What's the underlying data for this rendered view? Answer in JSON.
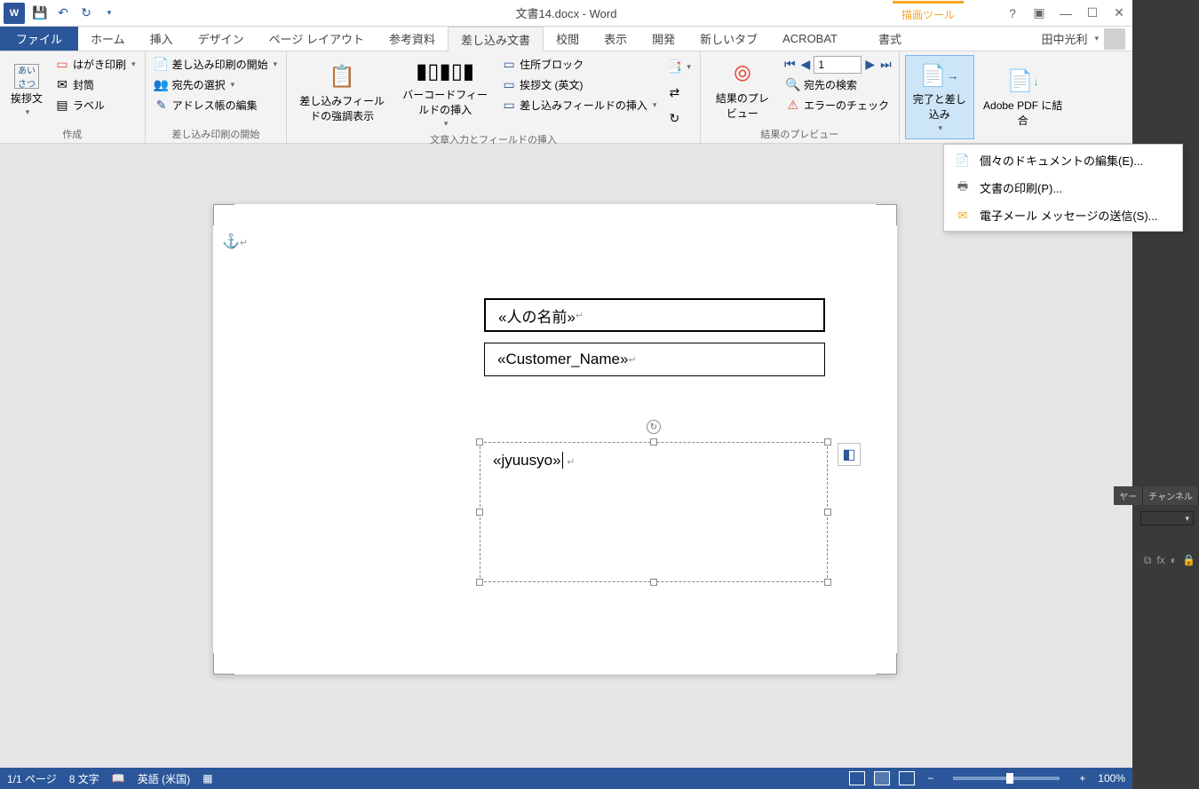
{
  "titlebar": {
    "title": "文書14.docx - Word",
    "contextual_tool": "描画ツール"
  },
  "tabs": {
    "file": "ファイル",
    "items": [
      "ホーム",
      "挿入",
      "デザイン",
      "ページ レイアウト",
      "参考資料",
      "差し込み文書",
      "校閲",
      "表示",
      "開発",
      "新しいタブ",
      "ACROBAT"
    ],
    "contextual": "書式",
    "active_index": 5
  },
  "account": {
    "name": "田中光利"
  },
  "ribbon": {
    "g1": {
      "label": "作成",
      "greeting": "挨拶文",
      "hagaki": "はがき印刷",
      "envelope": "封筒",
      "label_btn": "ラベル"
    },
    "g2": {
      "label": "差し込み印刷の開始",
      "start": "差し込み印刷の開始",
      "recipients": "宛先の選択",
      "edit_list": "アドレス帳の編集"
    },
    "g3": {
      "label": "文章入力とフィールドの挿入",
      "highlight": "差し込みフィールドの強調表示",
      "barcode": "バーコードフィールドの挿入",
      "address_block": "住所ブロック",
      "greeting_line": "挨拶文 (英文)",
      "insert_field": "差し込みフィールドの挿入"
    },
    "g4": {
      "label": "結果のプレビュー",
      "preview": "結果のプレビュー",
      "find": "宛先の検索",
      "check": "エラーのチェック",
      "record": "1"
    },
    "g5": {
      "finish": "完了と差し込み",
      "adobe": "Adobe PDF に結合"
    }
  },
  "dropdown": {
    "items": [
      "個々のドキュメントの編集(E)...",
      "文書の印刷(P)...",
      "電子メール メッセージの送信(S)..."
    ]
  },
  "document": {
    "field1": "«人の名前»",
    "field2": "«Customer_Name»",
    "field3": "«jyuusyo»"
  },
  "statusbar": {
    "page": "1/1 ページ",
    "words": "8 文字",
    "lang": "英語 (米国)",
    "zoom": "100%"
  },
  "side": {
    "tab1": "ヤー",
    "tab2": "チャンネル",
    "drop": "▾"
  }
}
